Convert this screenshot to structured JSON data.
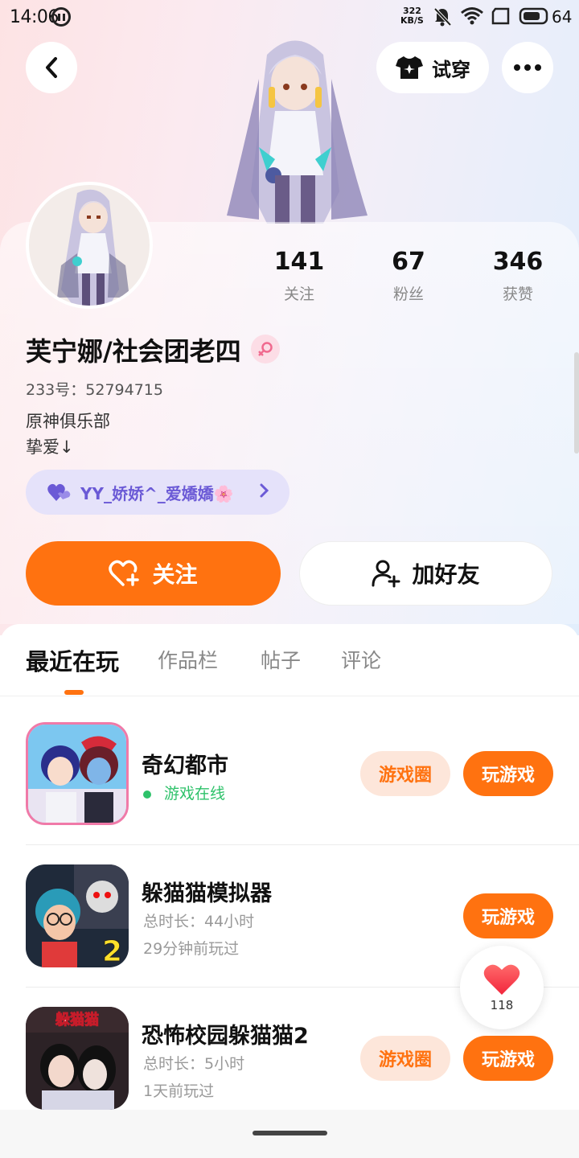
{
  "status_bar": {
    "time": "14:06",
    "net_speed_value": "322",
    "net_speed_unit": "KB/S",
    "battery": "64"
  },
  "header": {
    "try_on_label": "试穿"
  },
  "profile": {
    "stats": [
      {
        "value": "141",
        "label": "关注"
      },
      {
        "value": "67",
        "label": "粉丝"
      },
      {
        "value": "346",
        "label": "获赞"
      }
    ],
    "nickname": "芙宁娜/社会团老四",
    "uid": "233号：52794715",
    "bio_line1": "原神俱乐部",
    "bio_line2": "挚爱↓",
    "best_friend": "YY_娇娇^_爱嬌嬌🌸"
  },
  "actions": {
    "follow": "关注",
    "add_friend": "加好友"
  },
  "tabs": [
    "最近在玩",
    "作品栏",
    "帖子",
    "评论"
  ],
  "games": [
    {
      "title": "奇幻都市",
      "status": "游戏在线",
      "circle": "游戏圈",
      "play": "玩游戏"
    },
    {
      "title": "躲猫猫模拟器",
      "time": "总时长：44小时",
      "last": "29分钟前玩过",
      "play": "玩游戏"
    },
    {
      "title": "恐怖校园躲猫猫2",
      "time": "总时长：5小时",
      "last": "1天前玩过",
      "circle": "游戏圈",
      "play": "玩游戏"
    }
  ],
  "game_icon_texts": {
    "second": "2",
    "third": "躲猫猫"
  },
  "like_count": "118",
  "colors": {
    "accent": "#ff7210",
    "online": "#2ec26a",
    "friend_pill": "#e5e2fa"
  }
}
